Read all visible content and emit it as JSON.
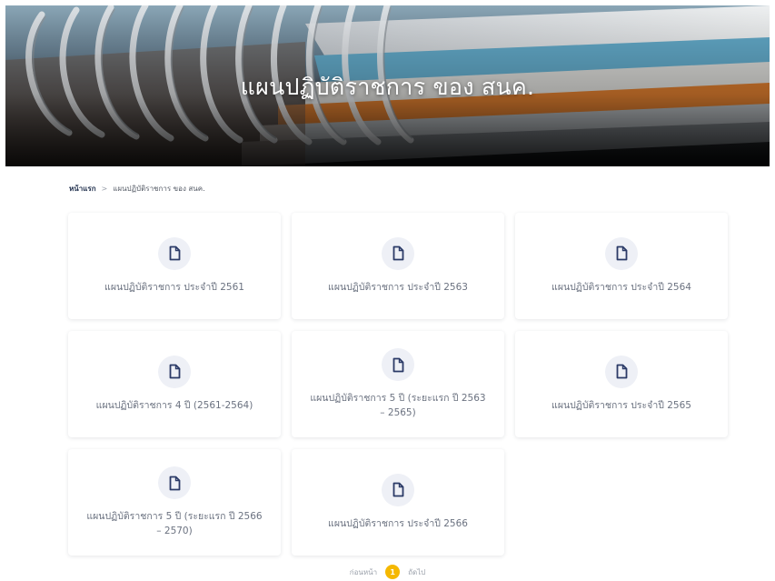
{
  "hero": {
    "title": "แผนปฏิบัติราชการ ของ สนค."
  },
  "breadcrumb": {
    "home": "หน้าแรก",
    "separator": ">",
    "current": "แผนปฏิบัติราชการ ของ สนค."
  },
  "cards": [
    {
      "label": "แผนปฏิบัติราชการ ประจำปี 2561",
      "icon": "document-icon"
    },
    {
      "label": "แผนปฏิบัติราชการ ประจำปี 2563",
      "icon": "document-icon"
    },
    {
      "label": "แผนปฏิบัติราชการ ประจำปี 2564",
      "icon": "document-icon"
    },
    {
      "label": "แผนปฏิบัติราชการ 4 ปี (2561-2564)",
      "icon": "document-icon"
    },
    {
      "label": "แผนปฏิบัติราชการ 5 ปี (ระยะแรก ปี 2563 – 2565)",
      "icon": "document-icon"
    },
    {
      "label": "แผนปฏิบัติราชการ ประจำปี 2565",
      "icon": "document-icon"
    },
    {
      "label": "แผนปฏิบัติราชการ 5 ปี (ระยะแรก ปี 2566 – 2570)",
      "icon": "document-icon"
    },
    {
      "label": "แผนปฏิบัติราชการ ประจำปี 2566",
      "icon": "document-icon"
    }
  ],
  "pagination": {
    "prev": "ก่อนหน้า",
    "current": "1",
    "next": "ถัดไป"
  },
  "colors": {
    "accent": "#f5b800",
    "icon": "#2b3a67",
    "icon_bg": "#eef0f6",
    "text": "#6b7280"
  }
}
